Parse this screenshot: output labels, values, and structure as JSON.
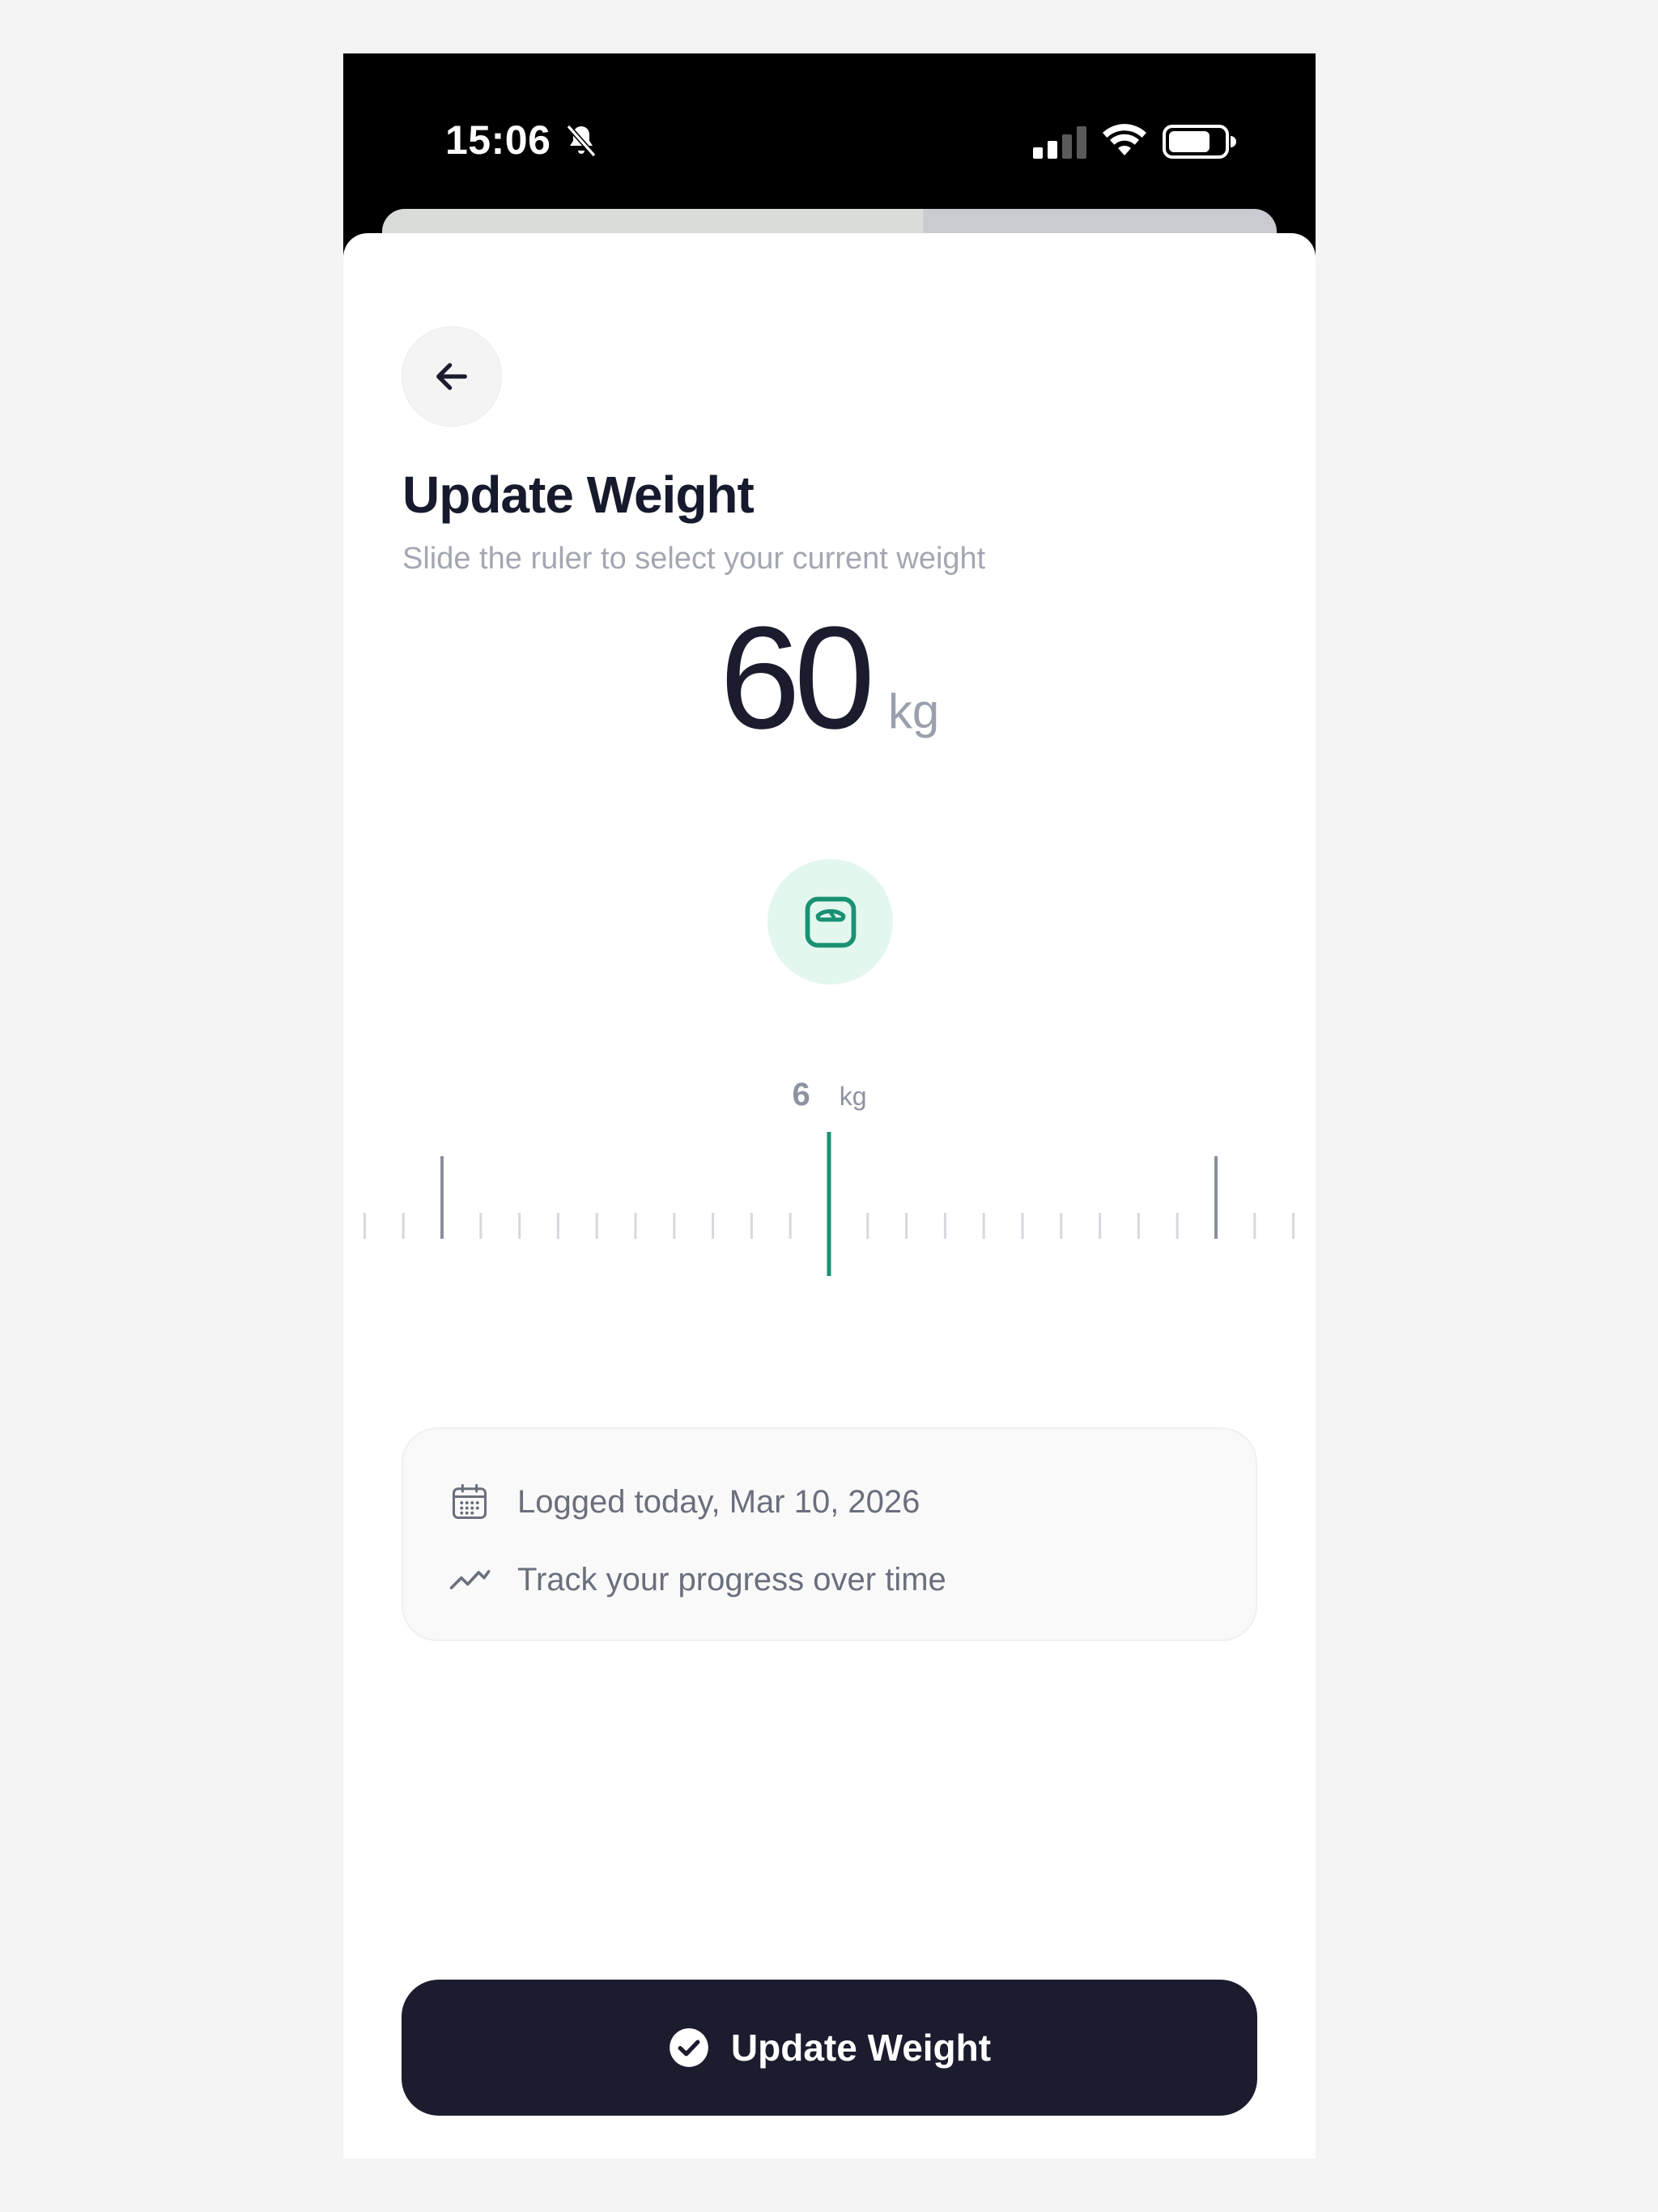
{
  "status_bar": {
    "time": "15:06",
    "icons": [
      "bell-slash-icon",
      "cellular-signal-icon",
      "wifi-icon",
      "battery-icon"
    ]
  },
  "header": {
    "back_icon": "arrow-left-icon",
    "title": "Update Weight",
    "subtitle": "Slide the ruler to select your current weight"
  },
  "weight": {
    "value": "60",
    "unit": "kg",
    "badge_icon": "scale-icon"
  },
  "ruler": {
    "readout_value": "6",
    "readout_unit": "kg",
    "selected_value": 60
  },
  "info": {
    "logged_icon": "calendar-icon",
    "logged_text": "Logged today, Mar 10, 2026",
    "progress_icon": "trend-line-icon",
    "progress_text": "Track your progress over time"
  },
  "actions": {
    "update_label": "Update Weight",
    "update_icon": "check-circle-icon"
  },
  "colors": {
    "accent": "#1a9173",
    "accent_soft": "#e3f7ef",
    "primary_button": "#1b1c2e",
    "title": "#171a2c",
    "muted_text": "#a3a7b2"
  }
}
